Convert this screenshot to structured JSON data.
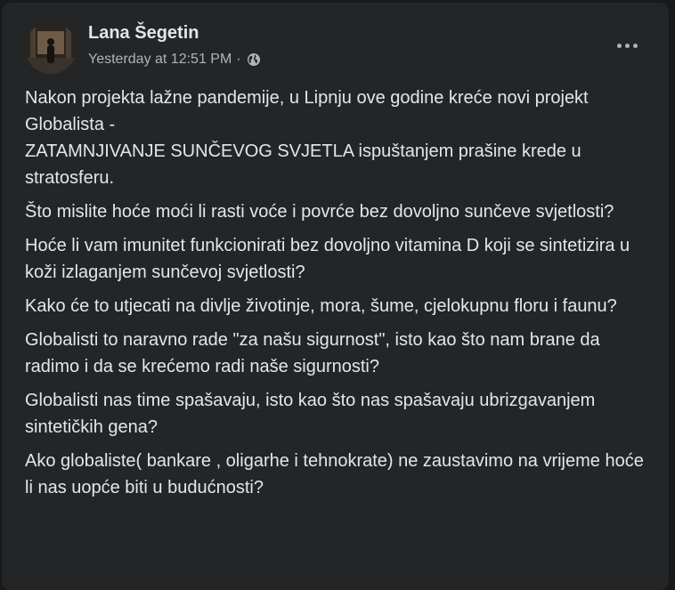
{
  "post": {
    "author": "Lana Šegetin",
    "timestamp": "Yesterday at 12:51 PM",
    "separator": "·",
    "audience_icon": "globe-icon",
    "more_icon": "more-horizontal-icon",
    "paragraphs": [
      "Nakon projekta lažne pandemije, u Lipnju ove godine kreće novi projekt Globalista -\nZATAMNJIVANJE SUNČEVOG SVJETLA ispuštanjem prašine krede u stratosferu.",
      "Što mislite hoće moći li rasti voće i povrće bez dovoljno sunčeve svjetlosti?",
      "Hoće li vam imunitet funkcionirati bez dovoljno vitamina D koji se sintetizira u koži izlaganjem sunčevoj svjetlosti?",
      "Kako će to utjecati na divlje životinje, mora, šume, cjelokupnu floru i faunu?",
      "Globalisti to naravno rade \"za našu sigurnost\", isto kao što nam brane da radimo i da se krećemo radi naše sigurnosti?",
      "Globalisti nas time spašavaju, isto kao što nas spašavaju ubrizgavanjem sintetičkih gena?",
      "Ako globaliste( bankare , oligarhe i tehnokrate) ne zaustavimo na vrijeme hoće li nas uopće biti u budućnosti?"
    ]
  },
  "colors": {
    "page_background": "#18191a",
    "card_background": "#242526",
    "primary_text": "#e4e6eb",
    "secondary_text": "#b0b3b8"
  }
}
